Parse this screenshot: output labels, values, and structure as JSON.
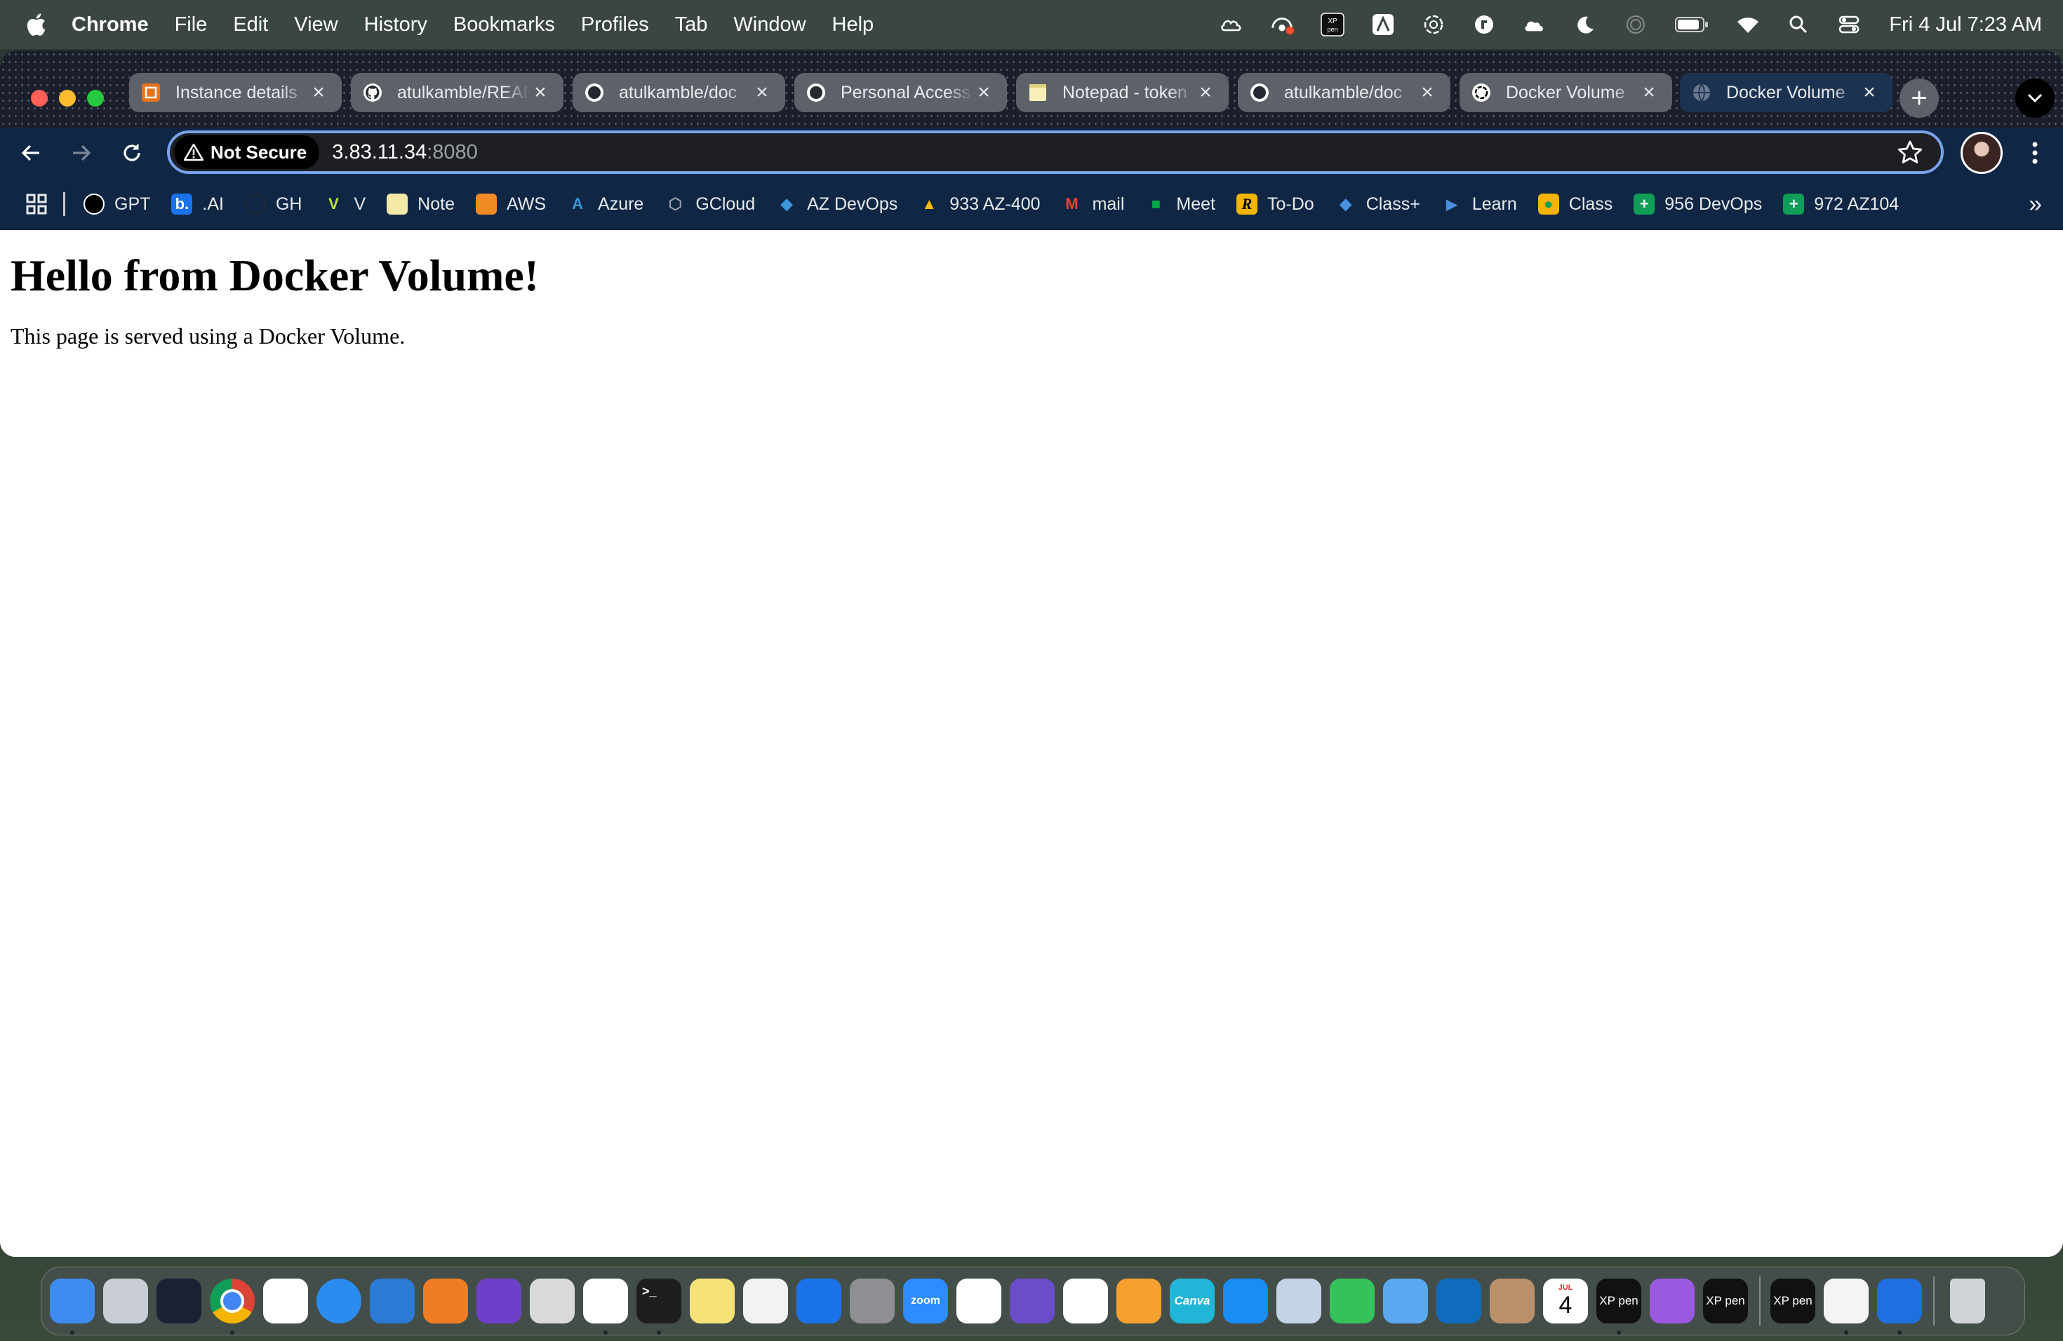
{
  "menubar": {
    "app": "Chrome",
    "items": [
      "File",
      "Edit",
      "View",
      "History",
      "Bookmarks",
      "Profiles",
      "Tab",
      "Window",
      "Help"
    ],
    "clock": "Fri 4 Jul  7:23 AM",
    "status_icons": [
      "creative-cloud-icon",
      "wifi-camera-icon",
      "xp-pen-icon",
      "artstudio-icon",
      "chatgpt-icon",
      "keyboard-maestro-icon",
      "icloud-icon",
      "focus-moon-icon",
      "fingerprint-icon",
      "battery-icon",
      "wifi-icon",
      "spotlight-icon",
      "control-center-icon"
    ]
  },
  "tabs": [
    {
      "title": "Instance details",
      "icon": "aws-instance-icon",
      "active": false
    },
    {
      "title": "atulkamble/READ",
      "icon": "github-icon",
      "active": false
    },
    {
      "title": "atulkamble/doc",
      "icon": "github-icon",
      "active": false
    },
    {
      "title": "Personal Access",
      "icon": "github-icon",
      "active": false
    },
    {
      "title": "Notepad - token",
      "icon": "notepad-icon",
      "active": false
    },
    {
      "title": "atulkamble/doc",
      "icon": "github-icon",
      "active": false
    },
    {
      "title": "Docker Volume",
      "icon": "chatgpt-icon",
      "active": false
    },
    {
      "title": "Docker Volume",
      "icon": "globe-icon",
      "active": true
    }
  ],
  "omnibox": {
    "security_label": "Not Secure",
    "host": "3.83.11.34",
    "port": ":8080"
  },
  "bookmarks": [
    {
      "label": "GPT",
      "icon": "chatgpt-icon",
      "color": "#000000"
    },
    {
      "label": ".AI",
      "icon": "b-ai-icon",
      "color": "#1a73e8"
    },
    {
      "label": "GH",
      "icon": "github-icon",
      "color": "#0f2745"
    },
    {
      "label": "V",
      "icon": "v-icon",
      "color": "#0f2745"
    },
    {
      "label": "Note",
      "icon": "note-icon",
      "color": "#f5e9a8"
    },
    {
      "label": "AWS",
      "icon": "aws-cube-icon",
      "color": "#f08a24"
    },
    {
      "label": "Azure",
      "icon": "azure-icon",
      "color": "#0f2745"
    },
    {
      "label": "GCloud",
      "icon": "gcloud-icon",
      "color": "#0f2745"
    },
    {
      "label": "AZ DevOps",
      "icon": "azure-devops-icon",
      "color": "#0f2745"
    },
    {
      "label": "933 AZ-400",
      "icon": "google-drive-icon",
      "color": "#0f2745"
    },
    {
      "label": "mail",
      "icon": "gmail-icon",
      "color": "#0f2745"
    },
    {
      "label": "Meet",
      "icon": "google-meet-icon",
      "color": "#0f2745"
    },
    {
      "label": "To-Do",
      "icon": "todo-icon",
      "color": "#f4b400"
    },
    {
      "label": "Class+",
      "icon": "classplus-icon",
      "color": "#0f2745"
    },
    {
      "label": "Learn",
      "icon": "learn-icon",
      "color": "#0f2745"
    },
    {
      "label": "Class",
      "icon": "google-classroom-icon",
      "color": "#f4b400"
    },
    {
      "label": "956 DevOps",
      "icon": "google-sheets-icon",
      "color": "#0f9d58"
    },
    {
      "label": "972 AZ104",
      "icon": "google-sheets-icon",
      "color": "#0f9d58"
    }
  ],
  "page": {
    "heading": "Hello from Docker Volume!",
    "paragraph": "This page is served using a Docker Volume."
  },
  "dock": [
    {
      "name": "finder-icon",
      "color": "#3d8bef",
      "running": true
    },
    {
      "name": "launchpad-icon",
      "color": "#c9ced6",
      "running": false
    },
    {
      "name": "obs-icon",
      "color": "#1c2033",
      "running": false
    },
    {
      "name": "chrome-icon",
      "color": "#e8eaed",
      "running": true
    },
    {
      "name": "chatgpt-icon",
      "color": "#ffffff",
      "running": false
    },
    {
      "name": "safari-icon",
      "color": "#2a8cf0",
      "running": false
    },
    {
      "name": "vscode-icon",
      "color": "#2b7ad6",
      "running": false
    },
    {
      "name": "sourcetree-icon",
      "color": "#f07d24",
      "running": false
    },
    {
      "name": "github-desktop-icon",
      "color": "#6e40c9",
      "running": false
    },
    {
      "name": "screenshot-icon",
      "color": "#d9d9d9",
      "running": false
    },
    {
      "name": "github-copilot-icon",
      "color": "#ffffff",
      "running": true
    },
    {
      "name": "terminal-icon",
      "color": "#1e1e1e",
      "running": true
    },
    {
      "name": "notes-icon",
      "color": "#f7e27a",
      "running": false
    },
    {
      "name": "freeform-icon",
      "color": "#f2f2f2",
      "running": false
    },
    {
      "name": "onedrive-icon",
      "color": "#1a73e8",
      "running": false
    },
    {
      "name": "system-settings-icon",
      "color": "#8e8e93",
      "running": false
    },
    {
      "name": "zoom-icon",
      "color": "#2d8cff",
      "running": false
    },
    {
      "name": "google-drive-icon",
      "color": "#ffffff",
      "running": false
    },
    {
      "name": "imovie-icon",
      "color": "#6a4dc9",
      "running": false
    },
    {
      "name": "reminders-icon",
      "color": "#ffffff",
      "running": false
    },
    {
      "name": "pages-icon",
      "color": "#f6a02d",
      "running": false
    },
    {
      "name": "canva-icon",
      "color": "#21b6d7",
      "running": false
    },
    {
      "name": "app-store-icon",
      "color": "#1a8cf5",
      "running": false
    },
    {
      "name": "preview-icon",
      "color": "#c5d3e8",
      "running": false
    },
    {
      "name": "numbers-icon",
      "color": "#35c25a",
      "running": false
    },
    {
      "name": "mail-icon",
      "color": "#5aa9f0",
      "running": false
    },
    {
      "name": "outlook-icon",
      "color": "#0f6cbd",
      "running": false
    },
    {
      "name": "contacts-icon",
      "color": "#b8916a",
      "running": false
    },
    {
      "name": "calendar-icon",
      "color": "#ffffff",
      "running": false
    },
    {
      "name": "xp-pen-icon",
      "color": "#111111",
      "running": true
    },
    {
      "name": "feedback-icon",
      "color": "#9b59e0",
      "running": false
    },
    {
      "name": "xp-pen-icon",
      "color": "#111111",
      "running": false
    },
    {
      "name": "separator",
      "color": "",
      "running": false
    },
    {
      "name": "xp-pen-icon",
      "color": "#111111",
      "running": false
    },
    {
      "name": "textedit-icon",
      "color": "#f4f4f4",
      "running": true
    },
    {
      "name": "xcode-icon",
      "color": "#1f6fe0",
      "running": true
    },
    {
      "name": "separator",
      "color": "",
      "running": false
    },
    {
      "name": "trash-icon",
      "color": "#d0d4d8",
      "running": false
    }
  ],
  "dock_labels": {
    "zoom": "zoom",
    "canva": "Canva",
    "calendar_month": "JUL",
    "calendar_day": "4",
    "xppen": "XP pen"
  }
}
